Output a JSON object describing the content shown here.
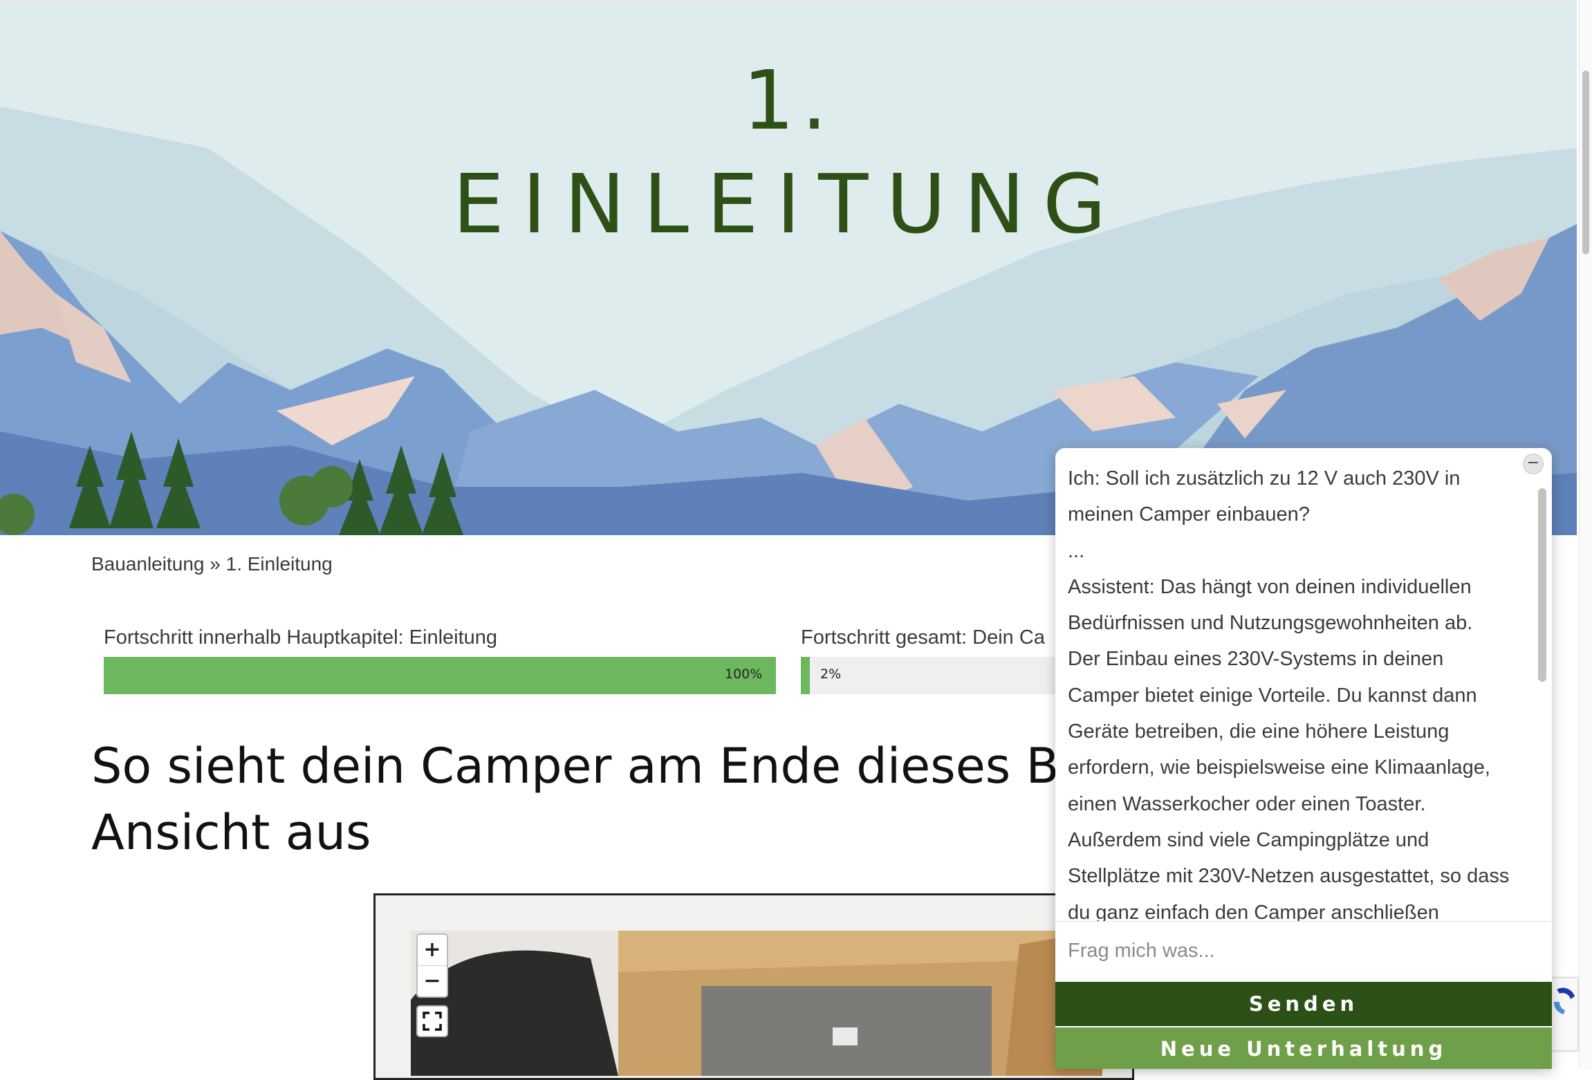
{
  "hero": {
    "number": "1.",
    "title": "EINLEITUNG"
  },
  "breadcrumb": {
    "parent": "Bauanleitung",
    "separator": "»",
    "current": "1. Einleitung"
  },
  "progress": [
    {
      "label": "Fortschritt innerhalb Hauptkapitel: Einleitung",
      "percent_text": "100%",
      "value": 100
    },
    {
      "label": "Fortschritt gesamt: Dein Ca",
      "percent_text": "2%",
      "value": 2
    }
  ],
  "headline": {
    "line1": "So sieht dein Camper am Ende dieses Buch",
    "line2": "Ansicht aus"
  },
  "viewer": {
    "zoom_in": "+",
    "zoom_out": "−"
  },
  "chat": {
    "close_label": "−",
    "messages": [
      "Ich: Soll ich zusätzlich zu 12 V auch 230V in meinen Camper einbauen?",
      "...",
      "Assistent: Das hängt von deinen individuellen Bedürfnissen und Nutzungsgewohnheiten ab. Der Einbau eines 230V-Systems in deinen Camper bietet einige Vorteile. Du kannst dann Geräte betreiben, die eine höhere Leistung erfordern, wie beispielsweise eine Klimaanlage, einen Wasserkocher oder einen Toaster. Außerdem sind viele Campingplätze und Stellplätze mit 230V-Netzen ausgestattet, so dass du ganz einfach den Camper anschließen"
    ],
    "input_placeholder": "Frag mich was...",
    "send_label": "Senden",
    "new_label": "Neue Unterhaltung"
  },
  "colors": {
    "brand_dark_green": "#2d5016",
    "accent_green": "#6f9f48",
    "progress_green": "#6db85e",
    "sky": "#dfecee"
  },
  "icons": [
    "fullscreen-icon",
    "zoom-in-icon",
    "zoom-out-icon",
    "minimize-icon"
  ]
}
